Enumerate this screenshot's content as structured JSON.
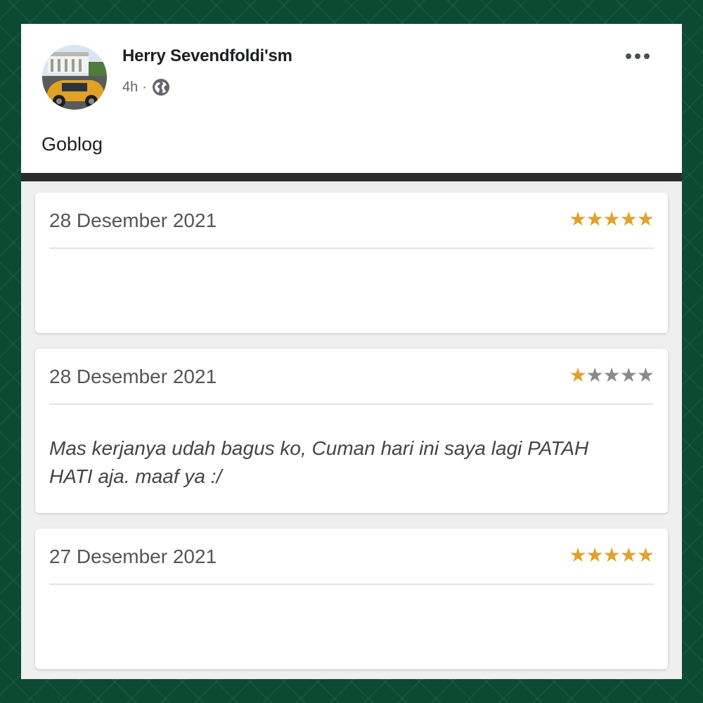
{
  "post": {
    "author": "Herry Sevendfoldi'sm",
    "time": "4h",
    "separator": "·",
    "audience_icon": "globe-icon",
    "menu_icon": "more-options-icon",
    "text": "Goblog"
  },
  "reviews": [
    {
      "date": "28 Desember 2021",
      "rating": 5,
      "max_rating": 5,
      "comment": ""
    },
    {
      "date": "28 Desember 2021",
      "rating": 1,
      "max_rating": 5,
      "comment": "Mas kerjanya udah bagus ko, Cuman hari ini saya lagi PATAH HATI aja. maaf ya :/"
    },
    {
      "date": "27 Desember 2021",
      "rating": 5,
      "max_rating": 5,
      "comment": ""
    }
  ],
  "colors": {
    "background": "#0c4a33",
    "star_filled": "#e0a22c",
    "star_empty": "#8a8a8a",
    "divider": "#2b2b2b"
  }
}
